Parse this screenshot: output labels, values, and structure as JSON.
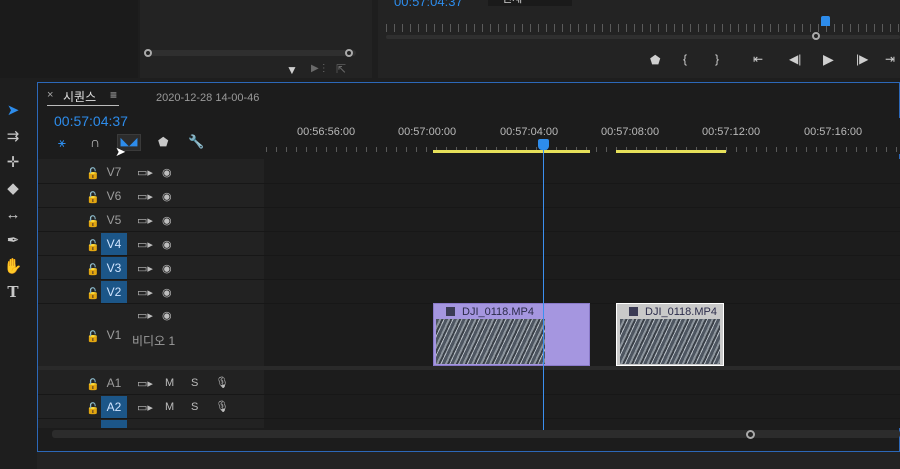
{
  "program_monitor": {
    "timecode": "00:57:04:37",
    "fit_label": "전체",
    "buttons": [
      "marker",
      "mark-in",
      "mark-out",
      "go-to-in",
      "step-back",
      "play",
      "step-forward",
      "go-to-out"
    ]
  },
  "sequence": {
    "tab_close": "×",
    "tab_title": "시퀀스",
    "tab_menu": "≡",
    "sequence_name": "2020-12-28 14-00-46",
    "timecode": "00:57:04:37",
    "ruler_labels": [
      "00:56:56:00",
      "00:57:00:00",
      "00:57:04:00",
      "00:57:08:00",
      "00:57:12:00",
      "00:57:16:00"
    ]
  },
  "tracks": {
    "video": [
      {
        "label": "V7",
        "targeted": false
      },
      {
        "label": "V6",
        "targeted": false
      },
      {
        "label": "V5",
        "targeted": false
      },
      {
        "label": "V4",
        "targeted": true
      },
      {
        "label": "V3",
        "targeted": true
      },
      {
        "label": "V2",
        "targeted": true
      },
      {
        "label": "V1",
        "targeted": false,
        "name": "비디오 1"
      }
    ],
    "audio": [
      {
        "label": "A1",
        "targeted": false,
        "m": "M",
        "s": "S"
      },
      {
        "label": "A2",
        "targeted": true,
        "m": "M",
        "s": "S"
      }
    ]
  },
  "clips": [
    {
      "name": "DJI_0118.MP4",
      "track": "V1"
    },
    {
      "name": "DJI_0118.MP4",
      "track": "V1"
    }
  ],
  "colors": {
    "accent_blue": "#2d8ceb",
    "clip_purple": "#a596e0",
    "target_blue": "#1c5688",
    "workarea_yellow": "#e6e05a",
    "panel_border": "#2c68b8"
  }
}
